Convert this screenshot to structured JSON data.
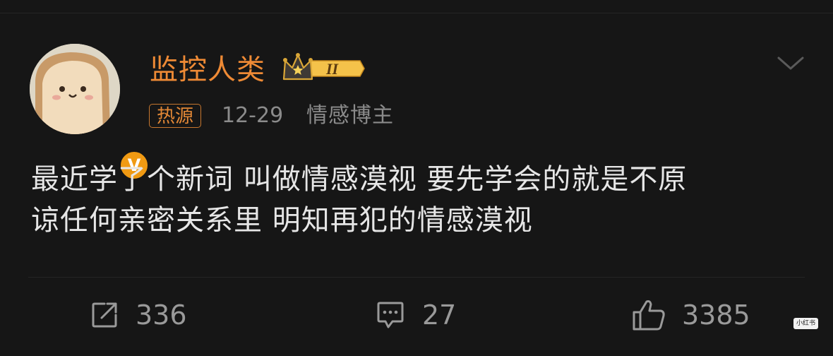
{
  "post": {
    "author": {
      "name": "监控人类",
      "level_badge": "II",
      "verified_mark": "V",
      "description": "情感博主"
    },
    "source_tag": "热源",
    "date": "12-29",
    "text_lines": [
      "最近学了个新词 叫做情感漠视 要先学会的就是不原",
      "谅任何亲密关系里 明知再犯的情感漠视"
    ]
  },
  "actions": {
    "repost_count": "336",
    "comment_count": "27",
    "like_count": "3385"
  },
  "watermark": "小红书",
  "icons": [
    "avatar-image",
    "crown-badge-icon",
    "chevron-down-icon",
    "share-icon",
    "comment-icon",
    "thumbs-up-icon"
  ],
  "colors": {
    "background": "#161616",
    "username": "#ee8a35",
    "tag": "#e38836",
    "body_text": "#e6e6e6",
    "meta_text": "#8b8b8b",
    "verified_badge": "#f09a13"
  }
}
